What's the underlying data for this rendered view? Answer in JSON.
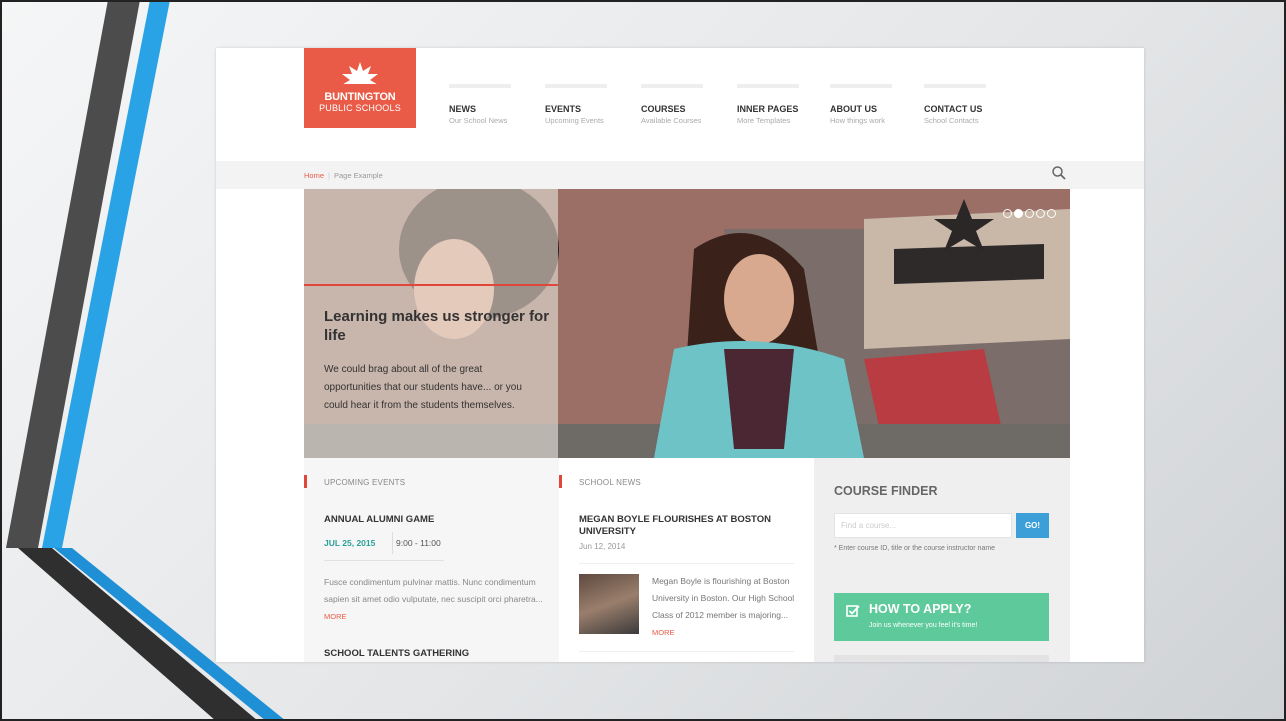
{
  "logo": {
    "line1": "BUNTINGTON",
    "line2": "PUBLIC SCHOOLS"
  },
  "nav": [
    {
      "title": "NEWS",
      "subtitle": "Our School News"
    },
    {
      "title": "EVENTS",
      "subtitle": "Upcoming Events"
    },
    {
      "title": "COURSES",
      "subtitle": "Available Courses"
    },
    {
      "title": "INNER PAGES",
      "subtitle": "More Templates"
    },
    {
      "title": "ABOUT US",
      "subtitle": "How things work"
    },
    {
      "title": "CONTACT US",
      "subtitle": "School Contacts"
    }
  ],
  "breadcrumb": {
    "home": "Home",
    "separator": "|",
    "current": "Page Example"
  },
  "hero": {
    "title": "Learning makes us stronger for life",
    "text": "We could brag about all of the great opportunities that our students have... or you could hear it from the students themselves.",
    "slide_count": 5,
    "active_slide": 2
  },
  "events": {
    "heading": "UPCOMING EVENTS",
    "item1": {
      "title": "ANNUAL ALUMNI GAME",
      "date": "JUL 25, 2015",
      "time": "9:00 - 11:00",
      "text": "Fusce condimentum pulvinar mattis. Nunc condimentum sapien sit amet odio vulputate, nec suscipit orci pharetra...",
      "more": "MORE"
    },
    "item2": {
      "title": "SCHOOL TALENTS GATHERING"
    }
  },
  "news": {
    "heading": "SCHOOL NEWS",
    "item1": {
      "title": "MEGAN BOYLE FLOURISHES AT BOSTON UNIVERSITY",
      "date": "Jun 12, 2014",
      "text": "Megan Boyle is flourishing at Boston University in Boston. Our High School Class of 2012 member is majoring...",
      "more": "MORE"
    }
  },
  "course_finder": {
    "title": "COURSE FINDER",
    "placeholder": "Find a course...",
    "button": "GO!",
    "hint": "* Enter course ID, title or the course instructor name"
  },
  "apply": {
    "title": "HOW TO APPLY?",
    "subtitle": "Join us whenever you feel it's time!"
  },
  "colors": {
    "brand_red": "#e95b47",
    "accent_red": "#e0463a",
    "go_blue": "#3d9fd8",
    "apply_green": "#5ec99a",
    "deco_blue": "#2b9fe3",
    "deco_gray": "#4a4a4a"
  }
}
